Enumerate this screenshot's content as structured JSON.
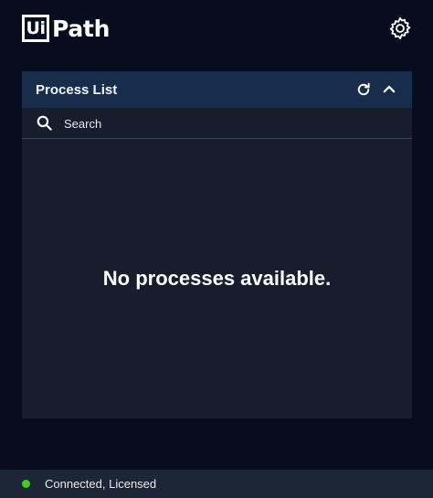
{
  "header": {
    "logo_box_text": "Ui",
    "logo_rest_text": "Path",
    "settings_icon": "gear-icon"
  },
  "panel": {
    "title": "Process List",
    "refresh_icon": "refresh-icon",
    "collapse_icon": "chevron-up-icon",
    "search": {
      "placeholder": "Search",
      "value": "",
      "icon": "search-icon"
    },
    "empty_message": "No processes available."
  },
  "status": {
    "text": "Connected, Licensed",
    "indicator_color": "#3ccf1d"
  },
  "colors": {
    "background": "#050d1f",
    "panel_header": "#182c4c",
    "panel_body": "#161e2e",
    "status_bar": "#1d2636"
  }
}
